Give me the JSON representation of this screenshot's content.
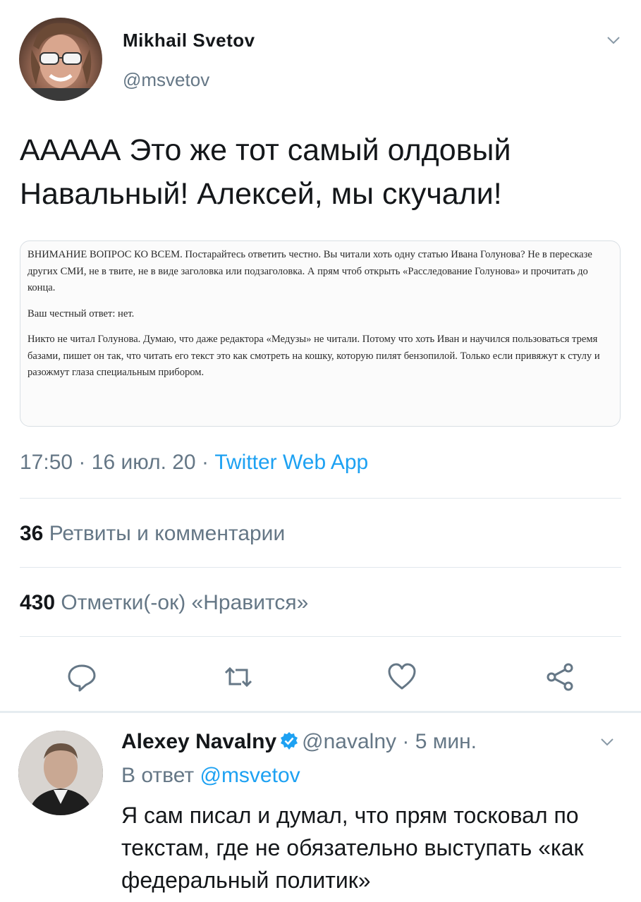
{
  "tweet": {
    "author_name": "Mikhail Svetov",
    "author_handle": "@msvetov",
    "text": "ААААА Это же тот самый олдовый Навальный! Алексей, мы скучали!",
    "quote_paragraphs": [
      "ВНИМАНИЕ ВОПРОС КО ВСЕМ. Постарайтесь ответить честно. Вы читали хоть одну статью Ивана Голунова? Не в пересказе других СМИ, не в твите, не в виде заголовка или подзаголовка. А прям чтоб открыть «Расследование Голунова» и прочитать до конца.",
      "Ваш честный ответ: нет.",
      "Никто не читал Голунова. Думаю, что даже редактора «Медузы» не читали. Потому что хоть Иван и научился пользоваться тремя базами, пишет он так, что читать его текст это как смотреть на кошку, которую пилят бензопилой. Только если привяжут к стулу и разожмут глаза специальным прибором."
    ],
    "time": "17:50",
    "date": "16 июл. 20",
    "separator": "·",
    "source": "Twitter Web App",
    "retweets_count": "36",
    "retweets_label": "Ретвиты и комментарии",
    "likes_count": "430",
    "likes_label": "Отметки(-ок) «Нравится»",
    "actions": [
      "reply-icon",
      "retweet-icon",
      "like-icon",
      "share-icon"
    ]
  },
  "reply": {
    "author_name": "Alexey Navalny",
    "author_handle": "@navalny",
    "separator": "·",
    "time_ago": "5 мин.",
    "reply_to_prefix": "В ответ",
    "reply_to_handle": "@msvetov",
    "text": "Я сам писал и думал, что прям тосковал по текстам, где не обязательно выступать «как федеральный политик»"
  },
  "colors": {
    "accent": "#1da1f2",
    "secondary_text": "#657786",
    "divider": "#e1e8ed"
  }
}
